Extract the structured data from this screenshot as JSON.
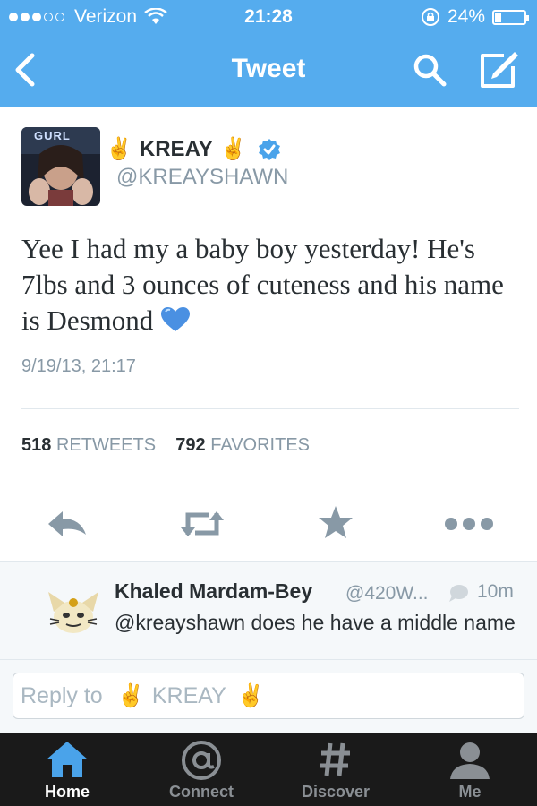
{
  "status_bar": {
    "carrier": "Verizon",
    "time": "21:28",
    "battery": "24%",
    "battery_level": 0.24
  },
  "nav": {
    "title": "Tweet",
    "back_icon": "back-icon",
    "search_icon": "search-icon",
    "compose_icon": "compose-icon"
  },
  "tweet": {
    "author_name": "KREAY",
    "name_emoji": "✌",
    "handle": "@KREAYSHAWN",
    "avatar_text": "GURL",
    "text": "Yee I had my a baby boy yesterday! He's 7lbs and 3 ounces of cuteness and his name is Desmond",
    "timestamp": "9/19/13, 21:17",
    "retweets_count": "518",
    "retweets_label": "RETWEETS",
    "favorites_count": "792",
    "favorites_label": "FAVORITES",
    "colors": {
      "accent": "#55acee",
      "heart": "#4a90e2"
    }
  },
  "reply": {
    "name": "Khaled Mardam-Bey",
    "handle": "@420W...",
    "time": "10m",
    "text": "@kreayshawn does he have a middle name"
  },
  "compose": {
    "placeholder": "Reply to",
    "name": "KREAY"
  },
  "tabs": [
    {
      "label": "Home",
      "icon": "home-icon",
      "active": true
    },
    {
      "label": "Connect",
      "icon": "at-icon",
      "active": false
    },
    {
      "label": "Discover",
      "icon": "hash-icon",
      "active": false
    },
    {
      "label": "Me",
      "icon": "person-icon",
      "active": false
    }
  ]
}
